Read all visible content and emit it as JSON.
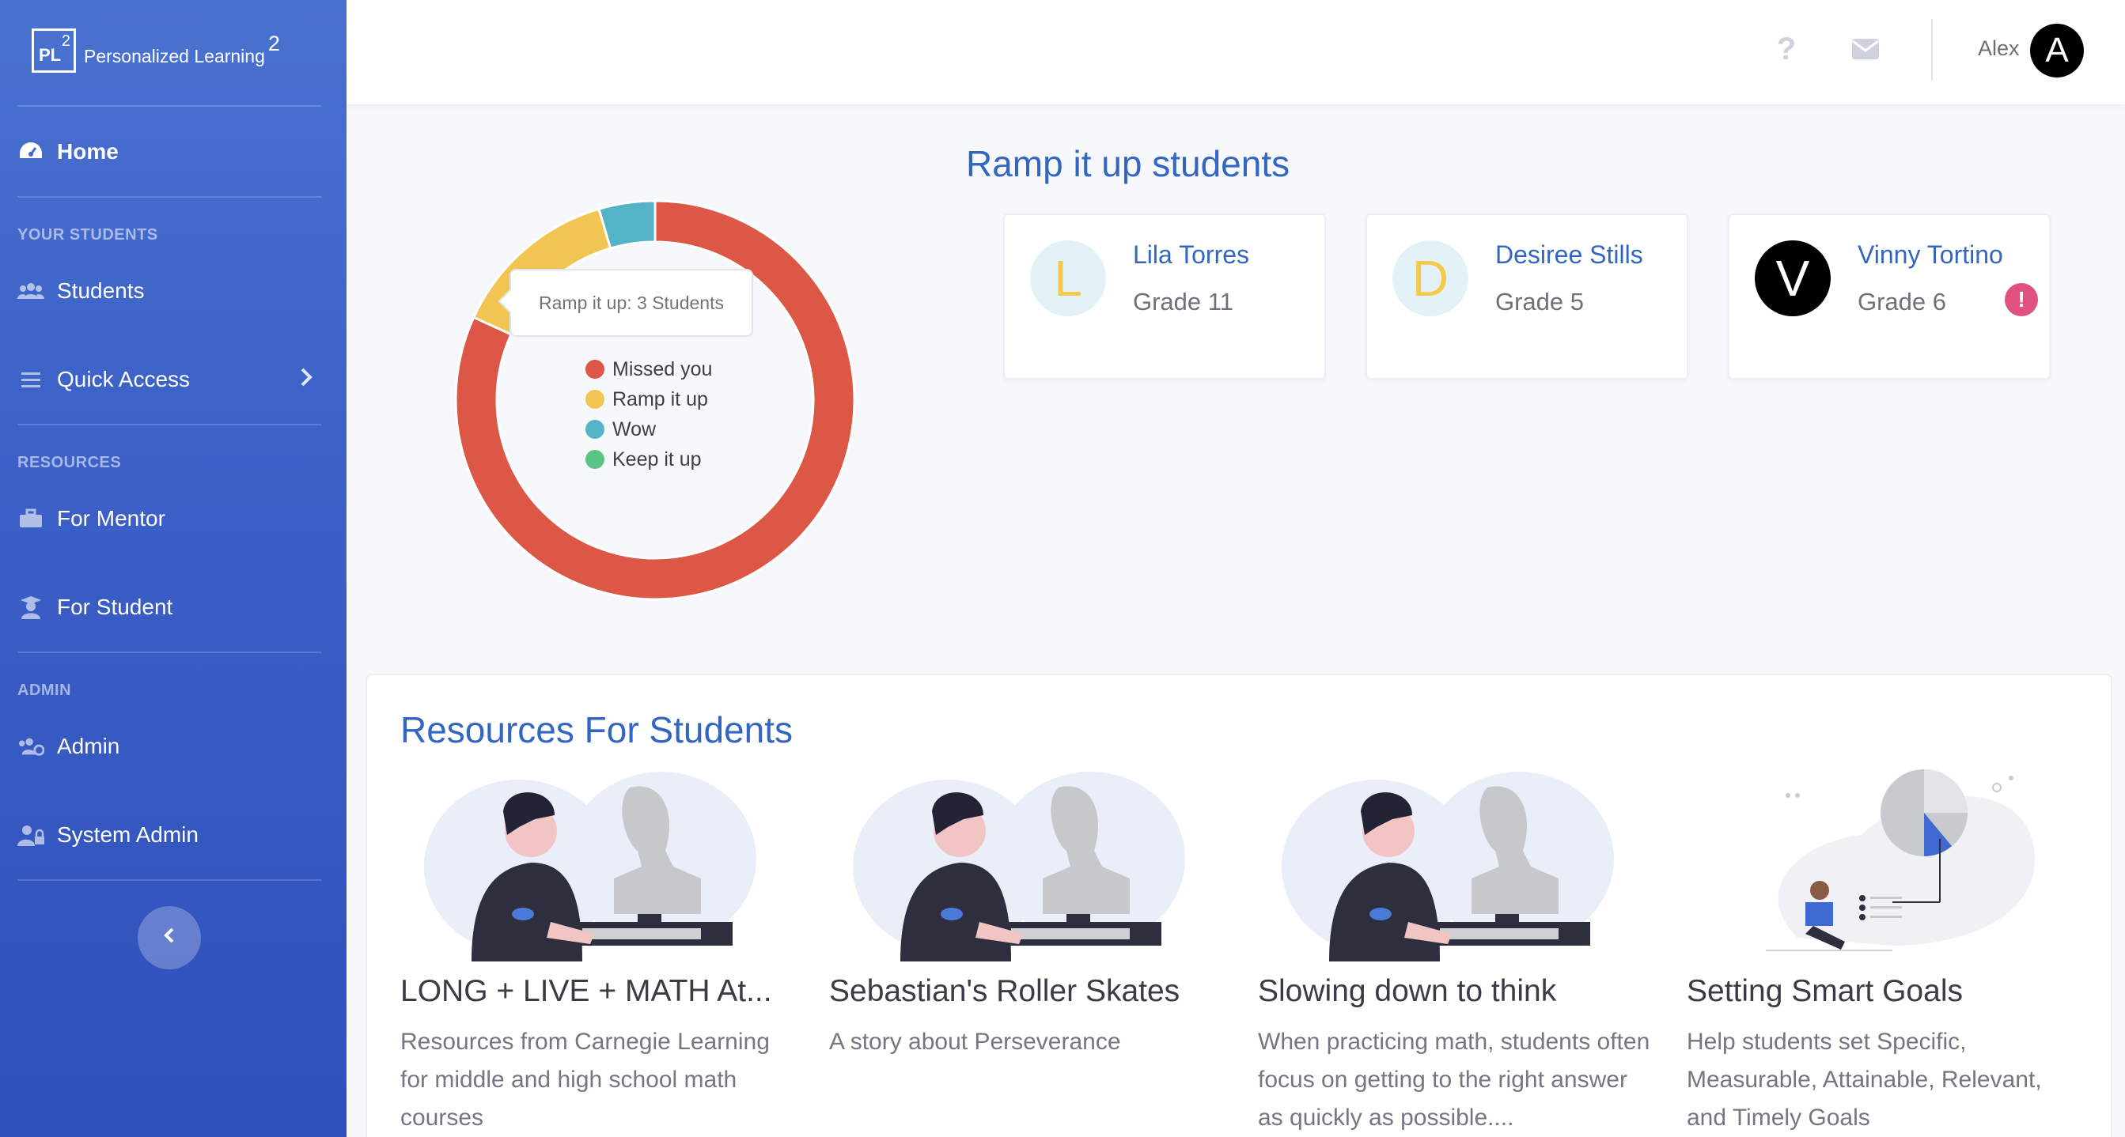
{
  "brand": {
    "logo_text": "PL",
    "logo_sup": "2",
    "name": "Personalized Learning",
    "name_sup": "2"
  },
  "sidebar": {
    "home": "Home",
    "sections": {
      "your_students": "YOUR STUDENTS",
      "resources": "RESOURCES",
      "admin": "ADMIN"
    },
    "items": {
      "students": "Students",
      "quick_access": "Quick Access",
      "for_mentor": "For Mentor",
      "for_student": "For Student",
      "admin": "Admin",
      "system_admin": "System Admin"
    },
    "collapse_icon": "chevron-left-icon"
  },
  "topbar": {
    "help_icon": "question-icon",
    "mail_icon": "envelope-icon",
    "user_name": "Alex",
    "avatar_letter": "A"
  },
  "chart_data": {
    "type": "pie",
    "subtype": "donut",
    "series": [
      {
        "name": "Missed you",
        "value": 18,
        "color": "#dc5745"
      },
      {
        "name": "Ramp it up",
        "value": 3,
        "color": "#f2c553"
      },
      {
        "name": "Wow",
        "value": 1,
        "color": "#55b3c7"
      },
      {
        "name": "Keep it up",
        "value": 0,
        "color": "#5bc484"
      }
    ],
    "tooltip": "Ramp it up: 3 Students",
    "legend_position": "center"
  },
  "ramp": {
    "title": "Ramp it up students",
    "students": [
      {
        "letter": "L",
        "name": "Lila Torres",
        "grade": "Grade 11",
        "avatar_bg": "#e3f2f6",
        "avatar_fg": "#f3c94e",
        "alert": false
      },
      {
        "letter": "D",
        "name": "Desiree Stills",
        "grade": "Grade 5",
        "avatar_bg": "#e3f2f6",
        "avatar_fg": "#f3c94e",
        "alert": false
      },
      {
        "letter": "V",
        "name": "Vinny Tortino",
        "grade": "Grade 6",
        "avatar_bg": "#000000",
        "avatar_fg": "#ffffff",
        "alert": true,
        "alert_text": "!"
      }
    ]
  },
  "resources": {
    "title": "Resources For Students",
    "cards": [
      {
        "name": "LONG + LIVE + MATH At...",
        "desc": "Resources from Carnegie Learning for middle and high school math courses",
        "illustration": "student-sculpting-illustration"
      },
      {
        "name": "Sebastian's Roller Skates",
        "desc": "A story about Perseverance",
        "illustration": "student-sculpting-illustration"
      },
      {
        "name": "Slowing down to think",
        "desc": "When practicing math, students often focus on getting to the right answer as quickly as possible....",
        "illustration": "student-sculpting-illustration"
      },
      {
        "name": "Setting Smart Goals",
        "desc": "Help students set Specific, Measurable, Attainable, Relevant, and Timely Goals",
        "illustration": "goals-chart-illustration"
      }
    ]
  }
}
